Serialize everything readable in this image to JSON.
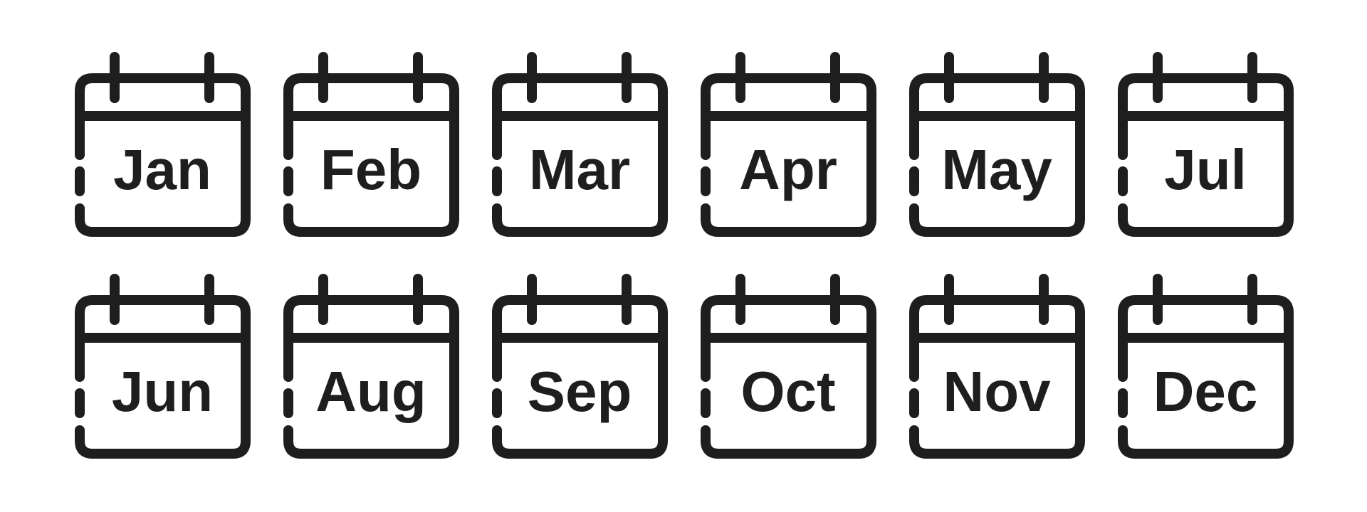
{
  "colors": {
    "stroke": "#1e1e1e",
    "background": "#ffffff"
  },
  "icon_name": "calendar-icon",
  "rows": [
    [
      "Jan",
      "Feb",
      "Mar",
      "Apr",
      "May",
      "Jul"
    ],
    [
      "Jun",
      "Aug",
      "Sep",
      "Oct",
      "Nov",
      "Dec"
    ]
  ]
}
